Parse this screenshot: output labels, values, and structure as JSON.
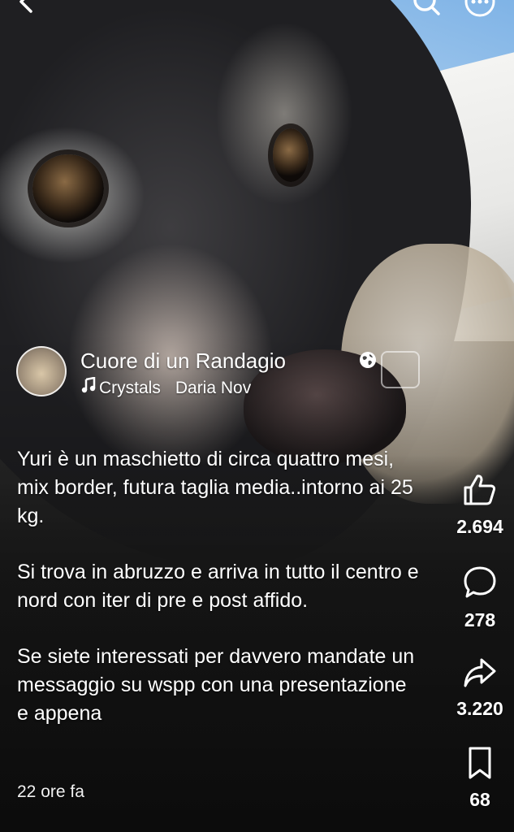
{
  "post": {
    "author": "Cuore di un Randagio",
    "music": {
      "track": "Crystals",
      "artist": "Daria Nov"
    },
    "caption": [
      "Yuri è un maschietto di circa quattro mesi, mix border, futura taglia media..intorno ai 25 kg.",
      "Si trova in abruzzo e arriva in tutto il centro e nord con iter di pre e post affido.",
      "Se siete interessati per davvero mandate un messaggio su wspp con una presentazione e appena"
    ],
    "timestamp": "22 ore fa"
  },
  "actions": {
    "likes": "2.694",
    "comments": "278",
    "shares": "3.220",
    "saves": "68"
  },
  "icons": {
    "back": "arrow-left-icon",
    "search": "search-icon",
    "more": "more-dots-icon",
    "privacy": "globe-icon",
    "music": "music-note-icon",
    "like": "thumbs-up-icon",
    "comment": "comment-bubble-icon",
    "share": "share-arrow-icon",
    "save": "bookmark-icon"
  }
}
